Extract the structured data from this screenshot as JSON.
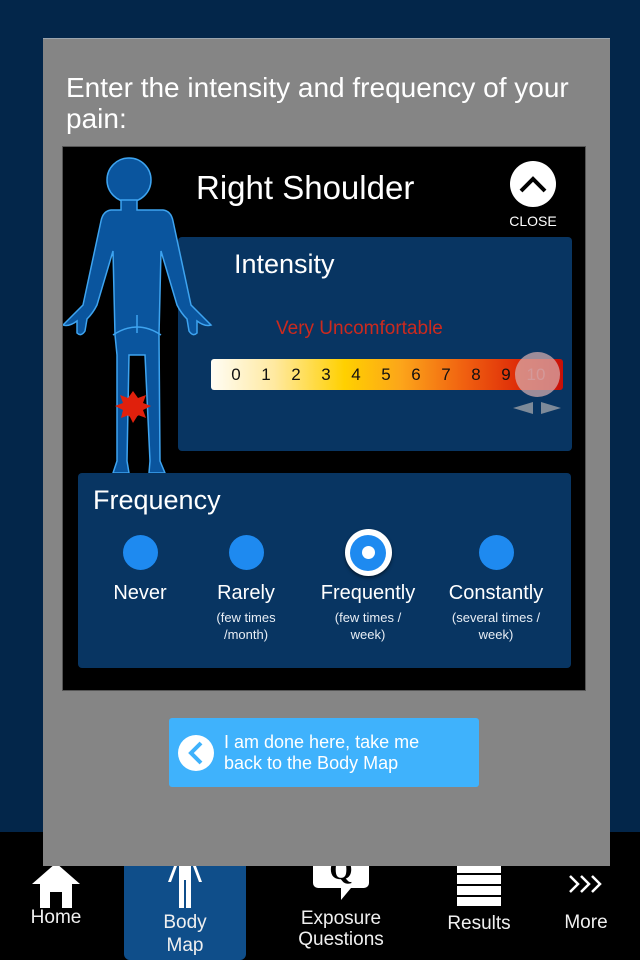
{
  "prompt": "Enter the intensity and frequency of your pain:",
  "card": {
    "region_title": "Right Shoulder",
    "close_label": "CLOSE",
    "close_icon": "chevron-up-icon",
    "figure": {
      "icon": "body-figure-icon",
      "pain_marker": "pain-burst-icon"
    },
    "intensity": {
      "title": "Intensity",
      "description": "Very Uncomfortable",
      "scale": [
        "0",
        "1",
        "2",
        "3",
        "4",
        "5",
        "6",
        "7",
        "8",
        "9",
        "10"
      ],
      "selected_value": 10,
      "slider_arrows_icon": "left-right-arrows-icon"
    },
    "frequency": {
      "title": "Frequency",
      "options": [
        {
          "label": "Never",
          "sub": ""
        },
        {
          "label": "Rarely",
          "sub": "(few times /month)"
        },
        {
          "label": "Frequently",
          "sub": "(few times / week)"
        },
        {
          "label": "Constantly",
          "sub": "(several times / week)"
        }
      ],
      "selected": "Frequently"
    }
  },
  "done_button": {
    "line1": "I am done here, take me",
    "line2": "back to the Body Map",
    "icon": "chevron-left-icon"
  },
  "tabbar": {
    "items": [
      {
        "label": "Home",
        "icon": "home-icon"
      },
      {
        "label_l1": "Body",
        "label_l2": "Map",
        "icon": "body-icon",
        "active": true
      },
      {
        "label_l1": "Exposure",
        "label_l2": "Questions",
        "icon": "question-bubble-icon"
      },
      {
        "label": "Results",
        "icon": "list-icon"
      },
      {
        "label": "More",
        "icon": "more-chevrons-icon"
      }
    ]
  },
  "colors": {
    "background": "#03264a",
    "panel": "#083562",
    "accent": "#1e8af0",
    "button": "#3fb2fc",
    "intensity_text": "#cc2a1e",
    "active_tab": "#0f4e8a"
  }
}
